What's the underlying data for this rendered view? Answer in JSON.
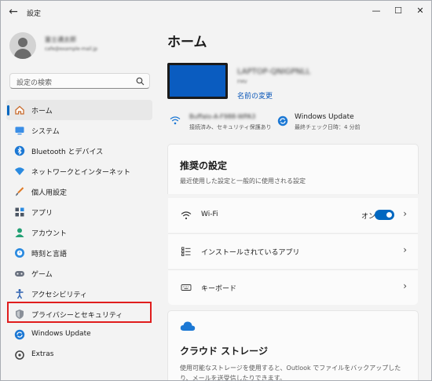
{
  "window": {
    "title": "設定"
  },
  "profile": {
    "name": "富士通太郎",
    "email": "cafe@example-mail.jp"
  },
  "search": {
    "placeholder": "設定の検索"
  },
  "sidebar": {
    "items": [
      {
        "label": "ホーム",
        "icon": "home-icon",
        "selected": true
      },
      {
        "label": "システム",
        "icon": "system-icon"
      },
      {
        "label": "Bluetooth とデバイス",
        "icon": "bluetooth-icon"
      },
      {
        "label": "ネットワークとインターネット",
        "icon": "network-icon"
      },
      {
        "label": "個人用設定",
        "icon": "brush-icon"
      },
      {
        "label": "アプリ",
        "icon": "apps-icon"
      },
      {
        "label": "アカウント",
        "icon": "account-icon"
      },
      {
        "label": "時刻と言語",
        "icon": "time-language-icon"
      },
      {
        "label": "ゲーム",
        "icon": "game-icon"
      },
      {
        "label": "アクセシビリティ",
        "icon": "accessibility-icon"
      },
      {
        "label": "プライバシーとセキュリティ",
        "icon": "shield-icon"
      },
      {
        "label": "Windows Update",
        "icon": "windows-update-icon"
      },
      {
        "label": "Extras",
        "icon": "extras-icon"
      }
    ]
  },
  "main": {
    "title": "ホーム",
    "device": {
      "name": "LAPTOP-QNIGPNLL",
      "model": "FMV",
      "rename_link": "名前の変更"
    },
    "network": {
      "ssid": "Buffalo-A-F988-WPA3",
      "status": "接続済み、セキュリティ保護あり"
    },
    "windows_update": {
      "title": "Windows Update",
      "status": "最終チェック日時：4 分前"
    },
    "recommended": {
      "title": "推奨の設定",
      "subtitle": "最近使用した設定と一般的に使用される設定",
      "rows": [
        {
          "label": "Wi-Fi",
          "toggle_label": "オン",
          "toggle_on": true
        },
        {
          "label": "インストールされているアプリ"
        },
        {
          "label": "キーボード"
        }
      ]
    },
    "cloud": {
      "title": "クラウド ストレージ",
      "description": "使用可能なストレージを使用すると、Outlook でファイルをバックアップしたり、メールを送受信したりできます。"
    }
  },
  "colors": {
    "accent": "#0067c0",
    "highlight_box": "#e01d1d",
    "monitor": "#0a5cc0"
  }
}
